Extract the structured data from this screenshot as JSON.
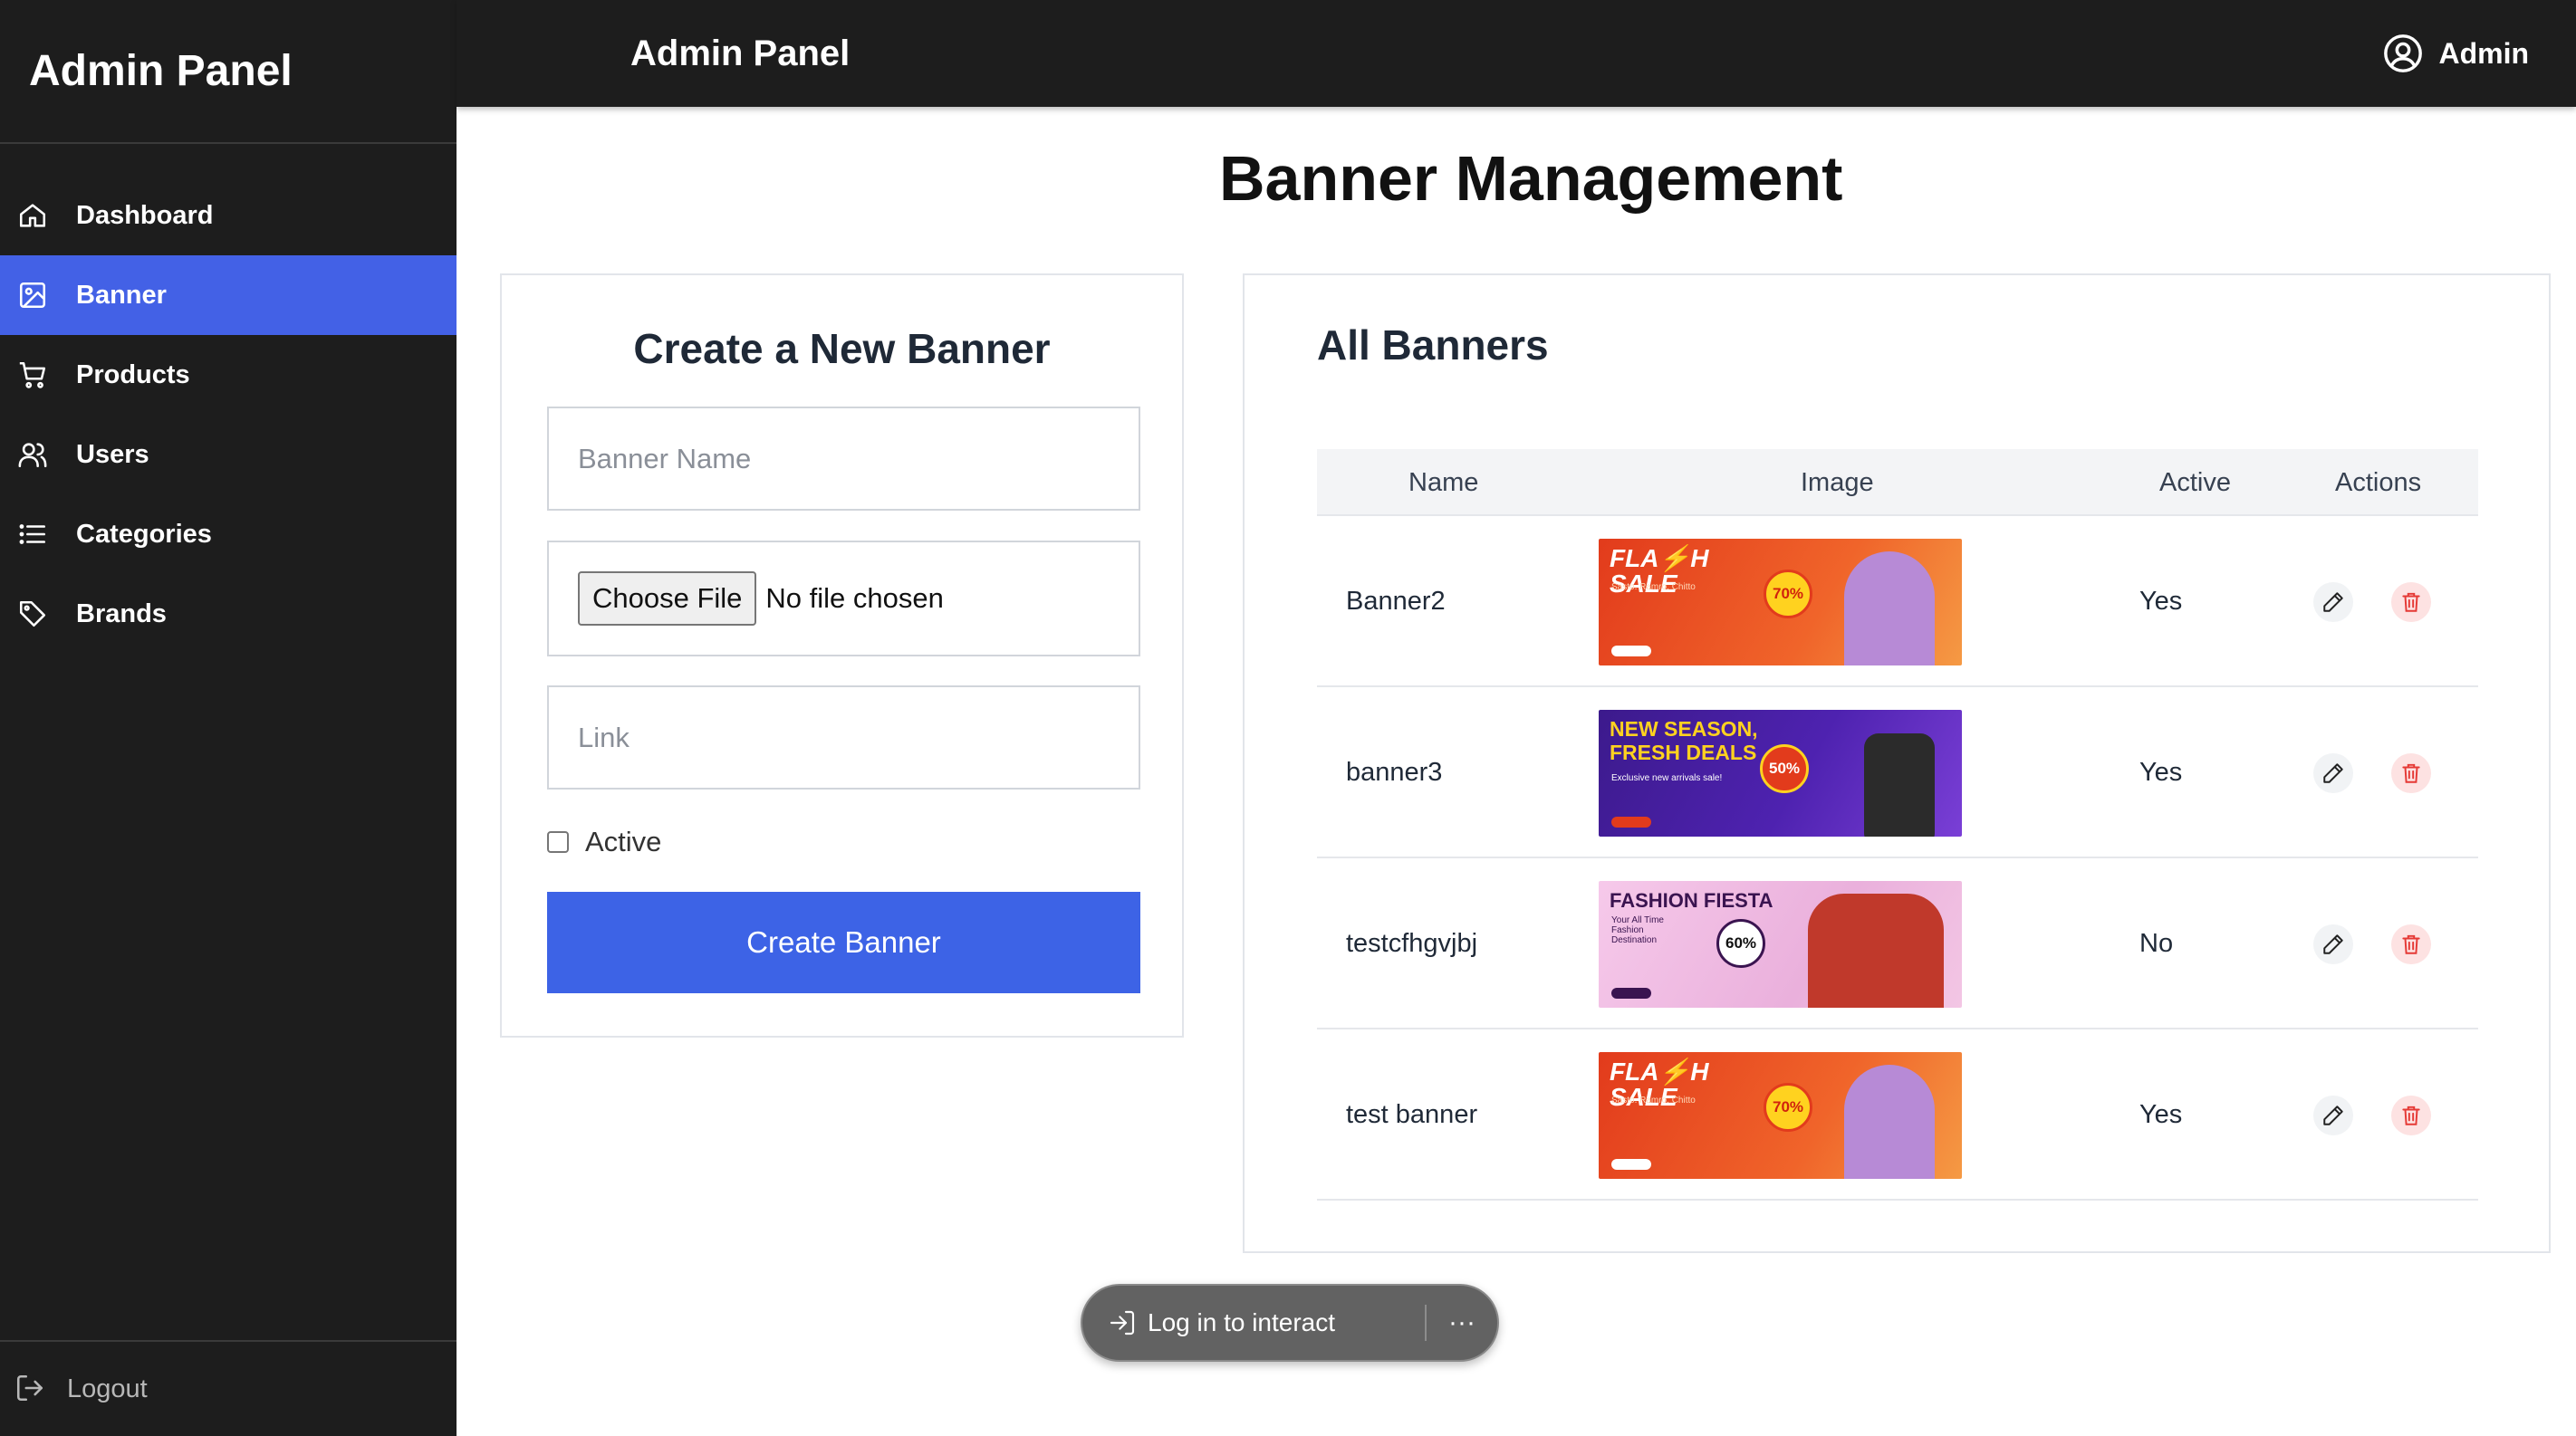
{
  "sidebar": {
    "brand": "Admin Panel",
    "items": [
      {
        "label": "Dashboard",
        "icon": "home-icon"
      },
      {
        "label": "Banner",
        "icon": "image-icon",
        "active": true
      },
      {
        "label": "Products",
        "icon": "cart-icon"
      },
      {
        "label": "Users",
        "icon": "users-icon"
      },
      {
        "label": "Categories",
        "icon": "list-icon"
      },
      {
        "label": "Brands",
        "icon": "tag-icon"
      }
    ],
    "logout": "Logout"
  },
  "topbar": {
    "title": "Admin Panel",
    "user": "Admin"
  },
  "page": {
    "title": "Banner Management"
  },
  "create_form": {
    "title": "Create a New Banner",
    "name_placeholder": "Banner Name",
    "file_button": "Choose File",
    "file_status": "No file chosen",
    "link_placeholder": "Link",
    "active_label": "Active",
    "submit": "Create Banner"
  },
  "banners": {
    "title": "All Banners",
    "columns": [
      "Name",
      "Image",
      "Active",
      "Actions"
    ],
    "rows": [
      {
        "name": "Banner2",
        "active": "Yes",
        "image": {
          "headline": "FLA⚡H SALE",
          "sub": "Sasto. Ramro. Chitto",
          "badge": "70%",
          "theme": "#e8501c"
        }
      },
      {
        "name": "banner3",
        "active": "Yes",
        "image": {
          "headline": "NEW SEASON, FRESH DEALS",
          "sub": "Exclusive new arrivals sale!",
          "badge": "50%",
          "theme": "#3c1a8c"
        }
      },
      {
        "name": "testcfhgvjbj",
        "active": "No",
        "image": {
          "headline": "FASHION FIESTA",
          "sub": "Your All Time Fashion Destination",
          "badge": "60%",
          "theme": "#f2b8e0"
        }
      },
      {
        "name": "test banner",
        "active": "Yes",
        "image": {
          "headline": "FLA⚡H SALE",
          "sub": "Sasto. Ramro. Chitto",
          "badge": "70%",
          "theme": "#e8501c"
        }
      }
    ]
  },
  "overlay": {
    "login": "Log in to interact",
    "more": "···"
  },
  "colors": {
    "accent": "#3d63e6",
    "sidebar_bg": "#1d1d1d",
    "active_nav": "#4361e6"
  }
}
